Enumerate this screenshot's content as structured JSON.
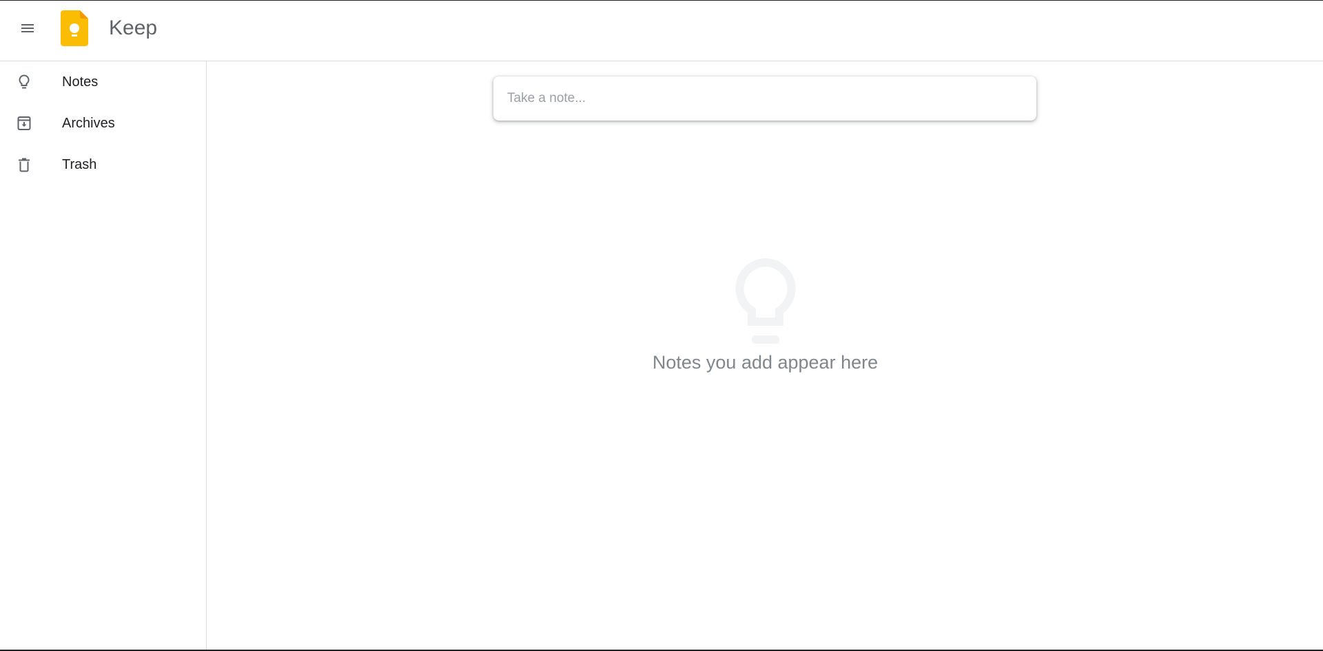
{
  "header": {
    "app_title": "Keep",
    "menu_icon": "hamburger-menu-icon",
    "logo_icon": "keep-logo-icon",
    "logo_color": "#FBBC04"
  },
  "sidebar": {
    "items": [
      {
        "label": "Notes",
        "icon": "lightbulb-icon"
      },
      {
        "label": "Archives",
        "icon": "archive-icon"
      },
      {
        "label": "Trash",
        "icon": "trash-icon"
      }
    ]
  },
  "main": {
    "note_input": {
      "placeholder": "Take a note...",
      "value": ""
    },
    "empty_state": {
      "icon": "lightbulb-icon",
      "text": "Notes you add appear here"
    }
  }
}
